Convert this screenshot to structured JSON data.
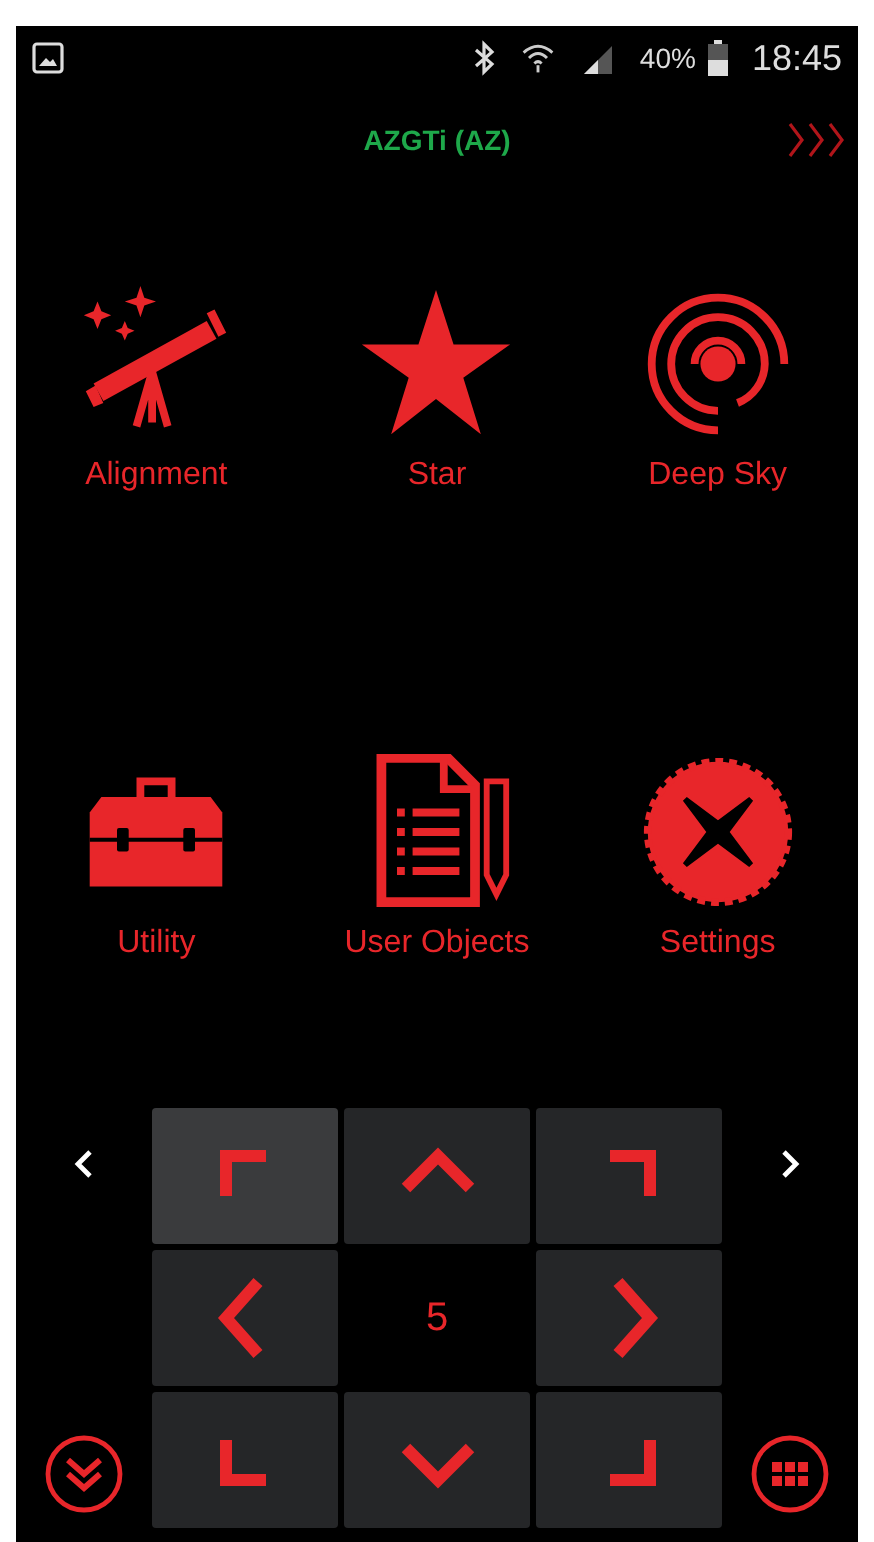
{
  "status_bar": {
    "battery_percent": "40%",
    "time": "18:45"
  },
  "header": {
    "title": "AZGTi (AZ)"
  },
  "menu": [
    {
      "label": "Alignment",
      "kind": "telescope"
    },
    {
      "label": "Star",
      "kind": "star"
    },
    {
      "label": "Deep Sky",
      "kind": "galaxy"
    },
    {
      "label": "Utility",
      "kind": "toolbox"
    },
    {
      "label": "User Objects",
      "kind": "document"
    },
    {
      "label": "Settings",
      "kind": "gear"
    }
  ],
  "pad": [
    {
      "kind": "nw",
      "selected": true
    },
    {
      "kind": "n",
      "selected": false
    },
    {
      "kind": "ne",
      "selected": false
    },
    {
      "kind": "w",
      "selected": false
    },
    {
      "kind": "speed",
      "label": "5"
    },
    {
      "kind": "e",
      "selected": false
    },
    {
      "kind": "sw",
      "selected": false
    },
    {
      "kind": "s",
      "selected": false
    },
    {
      "kind": "se",
      "selected": false
    }
  ]
}
